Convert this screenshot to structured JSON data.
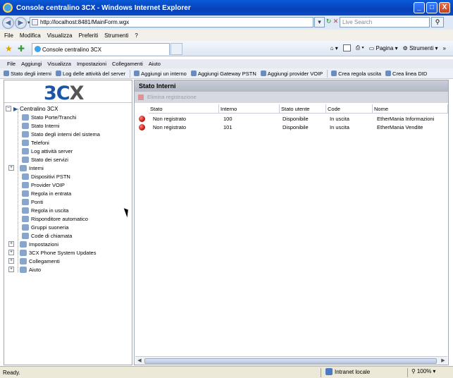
{
  "window": {
    "title": "Console centralino 3CX - Windows Internet Explorer",
    "buttons": {
      "minimize": "_",
      "maximize": "□",
      "close": "X"
    }
  },
  "address": {
    "url": "http://localhost:8481/MainForm.wgx",
    "search_placeholder": "Live Search"
  },
  "browser_menu": [
    "File",
    "Modifica",
    "Visualizza",
    "Preferiti",
    "Strumenti",
    "?"
  ],
  "tab": {
    "label": "Console centralino 3CX"
  },
  "command_bar": {
    "page": "Pagina",
    "tools": "Strumenti"
  },
  "app_menu": [
    "File",
    "Aggiungi",
    "Visualizza",
    "Impostazioni",
    "Collegamenti",
    "Aiuto"
  ],
  "app_toolbar": [
    "Stato degli interni",
    "Log delle attività del server",
    "Aggiungi un interno",
    "Aggiungi Gateway PSTN",
    "Aggiungi provider VOIP",
    "Crea regola uscita",
    "Crea linea DID"
  ],
  "logo": {
    "part1": "3C",
    "part2": "X"
  },
  "tree": {
    "root": "Centralino 3CX",
    "items": [
      "Stato Porte/Tranchi",
      "Stato Interni",
      "Stato degli interni del sistema",
      "Telefoni",
      "Log attività server",
      "Stato dei servizi",
      "Interni",
      "Dispositivi PSTN",
      "Provider VOIP",
      "Regola in entrata",
      "Ponti",
      "Regola in uscita",
      "Risponditore automatico",
      "Gruppi suoneria",
      "Code di chiamata",
      "Impostazioni",
      "3CX Phone System Updates",
      "Collegamenti",
      "Aiuto"
    ]
  },
  "pane": {
    "title": "Stato Interni",
    "sub_action": "Elimina registrazione",
    "columns": [
      "Stato",
      "Interno",
      "Stato utente",
      "Code",
      "Nome"
    ],
    "rows": [
      {
        "stato": "Non registrato",
        "interno": "100",
        "stato_utente": "Disponibile",
        "code": "In uscita",
        "nome": "EtherMania Informazioni"
      },
      {
        "stato": "Non registrato",
        "interno": "101",
        "stato_utente": "Disponibile",
        "code": "In uscita",
        "nome": "EtherMania Vendite"
      }
    ]
  },
  "status": {
    "ready": "Ready.",
    "zone": "Intranet locale",
    "zoom": "100%"
  }
}
